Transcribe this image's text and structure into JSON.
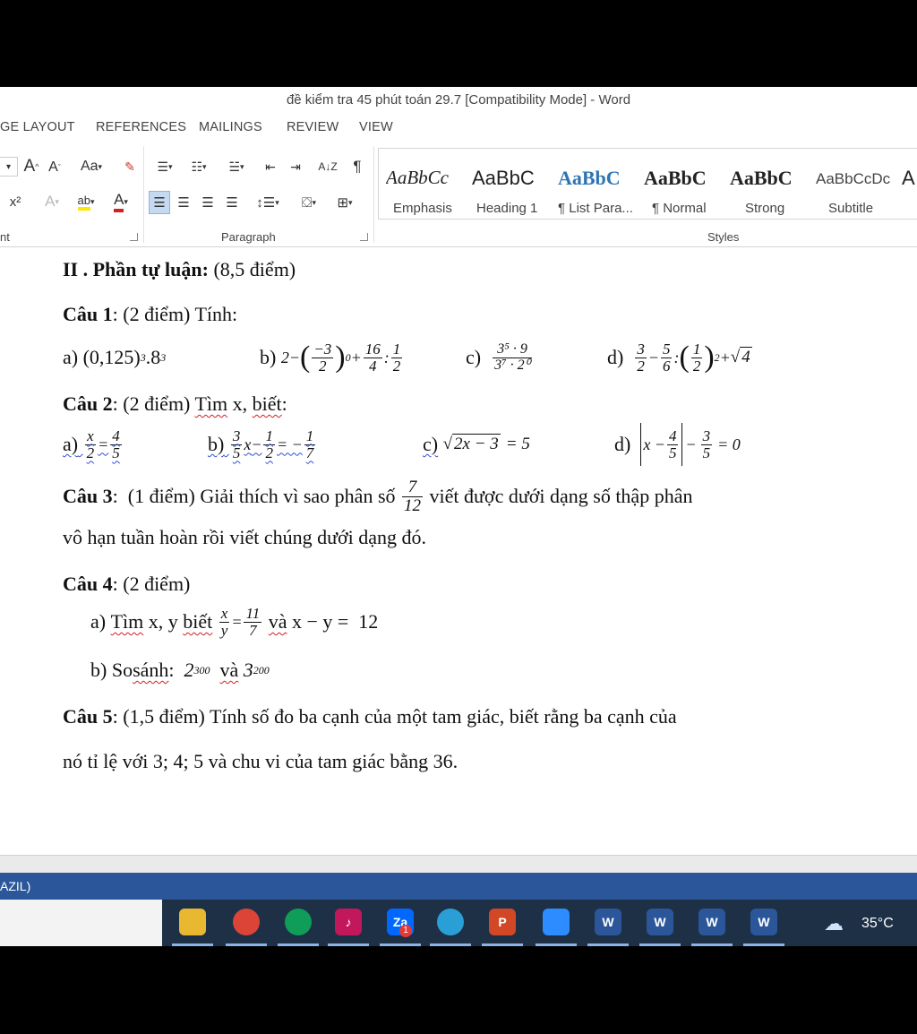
{
  "window": {
    "title": "đề kiểm tra 45 phút toán 29.7 [Compatibility Mode] - Word"
  },
  "tabs": [
    "GE LAYOUT",
    "REFERENCES",
    "MAILINGS",
    "REVIEW",
    "VIEW"
  ],
  "ribbon": {
    "font_group_label": "nt",
    "paragraph_label": "Paragraph",
    "styles_label": "Styles",
    "font_buttons": {
      "grow": "A",
      "shrink": "A",
      "case": "Aa",
      "superscript": "x²",
      "text_effects": "A",
      "highlight": "ab",
      "font_color": "A"
    },
    "sort": "A↓Z",
    "pilcrow": "¶",
    "styles": [
      {
        "sample": "AaBbCc",
        "name": "Emphasis"
      },
      {
        "sample": "AaBbC",
        "name": "Heading 1"
      },
      {
        "sample": "AaBbC",
        "name": "¶ List Para..."
      },
      {
        "sample": "AaBbC",
        "name": "¶ Normal"
      },
      {
        "sample": "AaBbC",
        "name": "Strong"
      },
      {
        "sample": "AaBbCcDc",
        "name": "Subtitle"
      },
      {
        "sample": "A",
        "name": ""
      }
    ]
  },
  "document": {
    "section_title": "II . Phần tự luận:",
    "section_points": " (8,5 điểm)",
    "q1": {
      "label": "Câu 1",
      "rest": ": (2 điểm) Tính:"
    },
    "q1_items": {
      "a_label": "a)",
      "a_base": "(0,125)",
      "a_exp": "3",
      "a_mid": ".8",
      "a_exp2": "3",
      "b_label": "b)",
      "b_two": "2",
      "b_minus": "−",
      "b_n1": "−3",
      "b_d1": "2",
      "b_exp": "0",
      "b_plus": "+",
      "b_n2": "16",
      "b_d2": "4",
      "b_colon": ":",
      "b_n3": "1",
      "b_d3": "2",
      "c_label": "c)",
      "c_num": "3⁵ · 9",
      "c_den": "3⁷ · 2⁰",
      "d_label": "d)",
      "d_n1": "3",
      "d_d1": "2",
      "d_minus": "−",
      "d_n2": "5",
      "d_d2": "6",
      "d_colon": ":",
      "d_n3": "1",
      "d_d3": "2",
      "d_exp": "2",
      "d_plus": "+",
      "d_rad": "4"
    },
    "q2": {
      "label": "Câu 2",
      "mid": ": (2 điểm) ",
      "tim": "Tìm",
      "x": " x, ",
      "biet": "biết",
      "colon": ":"
    },
    "q2_items": {
      "a_label": "a)",
      "a_n1": "x",
      "a_d1": "2",
      "a_eq": "=",
      "a_n2": "4",
      "a_d2": "5",
      "b_label": "b)",
      "b_n1": "3",
      "b_d1": "5",
      "b_x": "x",
      "b_minus": "−",
      "b_n2": "1",
      "b_d2": "2",
      "b_eq": "= −",
      "b_n3": "1",
      "b_d3": "7",
      "c_label": "c)",
      "c_rad": "2x − 3",
      "c_eq": "= 5",
      "d_label": "d)",
      "d_x": "x −",
      "d_n1": "4",
      "d_d1": "5",
      "d_minus": "−",
      "d_n2": "3",
      "d_d2": "5",
      "d_eq": "= 0"
    },
    "q3": {
      "label": "Câu 3",
      "pre": ":  (1 điểm) Giải thích vì sao phân số ",
      "n": "7",
      "d": "12",
      "post": " viết được dưới dạng số thập phân",
      "line2": "vô hạn tuần hoàn rồi viết chúng dưới dạng đó."
    },
    "q4": {
      "label": "Câu 4",
      "rest": ": (2 điểm)"
    },
    "q4_items": {
      "a_label": "a)",
      "a_tim": "Tìm",
      "a_xy": " x, y ",
      "a_biet": "biết",
      "a_n1": "x",
      "a_d1": "y",
      "a_eq": "=",
      "a_n2": "11",
      "a_d2": "7",
      "a_va": "và",
      "a_rest": " x − y =  12",
      "b_label": "b)",
      "b_so": "So ",
      "b_sanh": "sánh",
      "b_colon": ":",
      "b_base1": "2",
      "b_exp1": "300",
      "b_va": "và",
      "b_base2": "3",
      "b_exp2": "200"
    },
    "q5": {
      "label": "Câu 5",
      "rest": ": (1,5 điểm) Tính số đo ba cạnh của một tam giác, biết rằng ba cạnh của",
      "line2": "nó tỉ lệ với 3; 4; 5 và chu vi của tam giác bằng 36."
    }
  },
  "statusbar": {
    "language": "AZIL)"
  },
  "taskbar": {
    "apps": [
      {
        "icon": "file-explorer-icon",
        "color": "#e8b830",
        "label": ""
      },
      {
        "icon": "chrome-icon",
        "color": "#db4437",
        "label": ""
      },
      {
        "icon": "chrome-icon",
        "color": "#0f9d58",
        "label": ""
      },
      {
        "icon": "music-app-icon",
        "color": "#c2185b",
        "label": "♪"
      },
      {
        "icon": "zalo-icon",
        "color": "#0068ff",
        "label": "Za"
      },
      {
        "icon": "edge-icon",
        "color": "#2a9fd6",
        "label": ""
      },
      {
        "icon": "powerpoint-icon",
        "color": "#d24726",
        "label": "P"
      },
      {
        "icon": "zoom-icon",
        "color": "#2d8cff",
        "label": ""
      },
      {
        "icon": "word-icon",
        "color": "#2b579a",
        "label": "W"
      },
      {
        "icon": "word-icon",
        "color": "#2b579a",
        "label": "W"
      },
      {
        "icon": "word-icon",
        "color": "#2b579a",
        "label": "W"
      },
      {
        "icon": "word-icon",
        "color": "#2b579a",
        "label": "W"
      }
    ],
    "zalo_badge": "1",
    "temperature": "35°C"
  }
}
